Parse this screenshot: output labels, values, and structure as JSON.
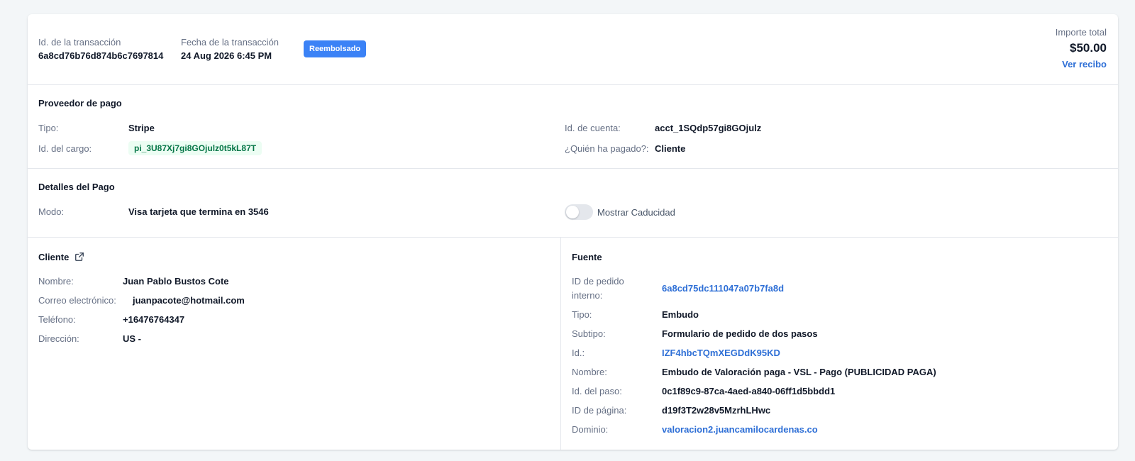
{
  "header": {
    "transaction_id_label": "Id. de la transacción",
    "transaction_id": "6a8cd76b76d874b6c7697814",
    "transaction_date_label": "Fecha de la transacción",
    "transaction_date": "24 Aug 2026 6:45 PM",
    "status_badge": "Reembolsado",
    "total_label": "Importe total",
    "total_amount": "$50.00",
    "receipt_link": "Ver recibo"
  },
  "provider": {
    "title": "Proveedor de pago",
    "type_label": "Tipo:",
    "type_value": "Stripe",
    "charge_label": "Id. del cargo:",
    "charge_value": "pi_3U87Xj7gi8GOjulz0t5kL87T",
    "account_label": "Id. de cuenta:",
    "account_value": "acct_1SQdp57gi8GOjulz",
    "payer_label": "¿Quién ha pagado?:",
    "payer_value": "Cliente"
  },
  "payment": {
    "title": "Detalles del Pago",
    "mode_label": "Modo:",
    "mode_value": "Visa tarjeta que termina en 3546",
    "toggle_label": "Mostrar Caducidad"
  },
  "client": {
    "title": "Cliente",
    "name_label": "Nombre:",
    "name_value": "Juan Pablo Bustos Cote",
    "email_label": "Correo electrónico:",
    "email_value": "juanpacote@hotmail.com",
    "phone_label": "Teléfono:",
    "phone_value": "+16476764347",
    "address_label": "Dirección:",
    "address_value": "US -"
  },
  "source": {
    "title": "Fuente",
    "order_label_1": "ID de pedido",
    "order_label_2": "interno:",
    "order_value": "6a8cd75dc111047a07b7fa8d",
    "type_label": "Tipo:",
    "type_value": "Embudo",
    "subtype_label": "Subtipo:",
    "subtype_value": "Formulario de pedido de dos pasos",
    "id_label": "Id.:",
    "id_value": "IZF4hbcTQmXEGDdK95KD",
    "name_label": "Nombre:",
    "name_value": "Embudo de Valoración paga - VSL - Pago (PUBLICIDAD PAGA)",
    "step_label": "Id. del paso:",
    "step_value": "0c1f89c9-87ca-4aed-a840-06ff1d5bbdd1",
    "page_label": "ID de página:",
    "page_value": "d19f3T2w28v5MzrhLHwc",
    "domain_label": "Dominio:",
    "domain_value": "valoracion2.juancamilocardenas.co"
  }
}
